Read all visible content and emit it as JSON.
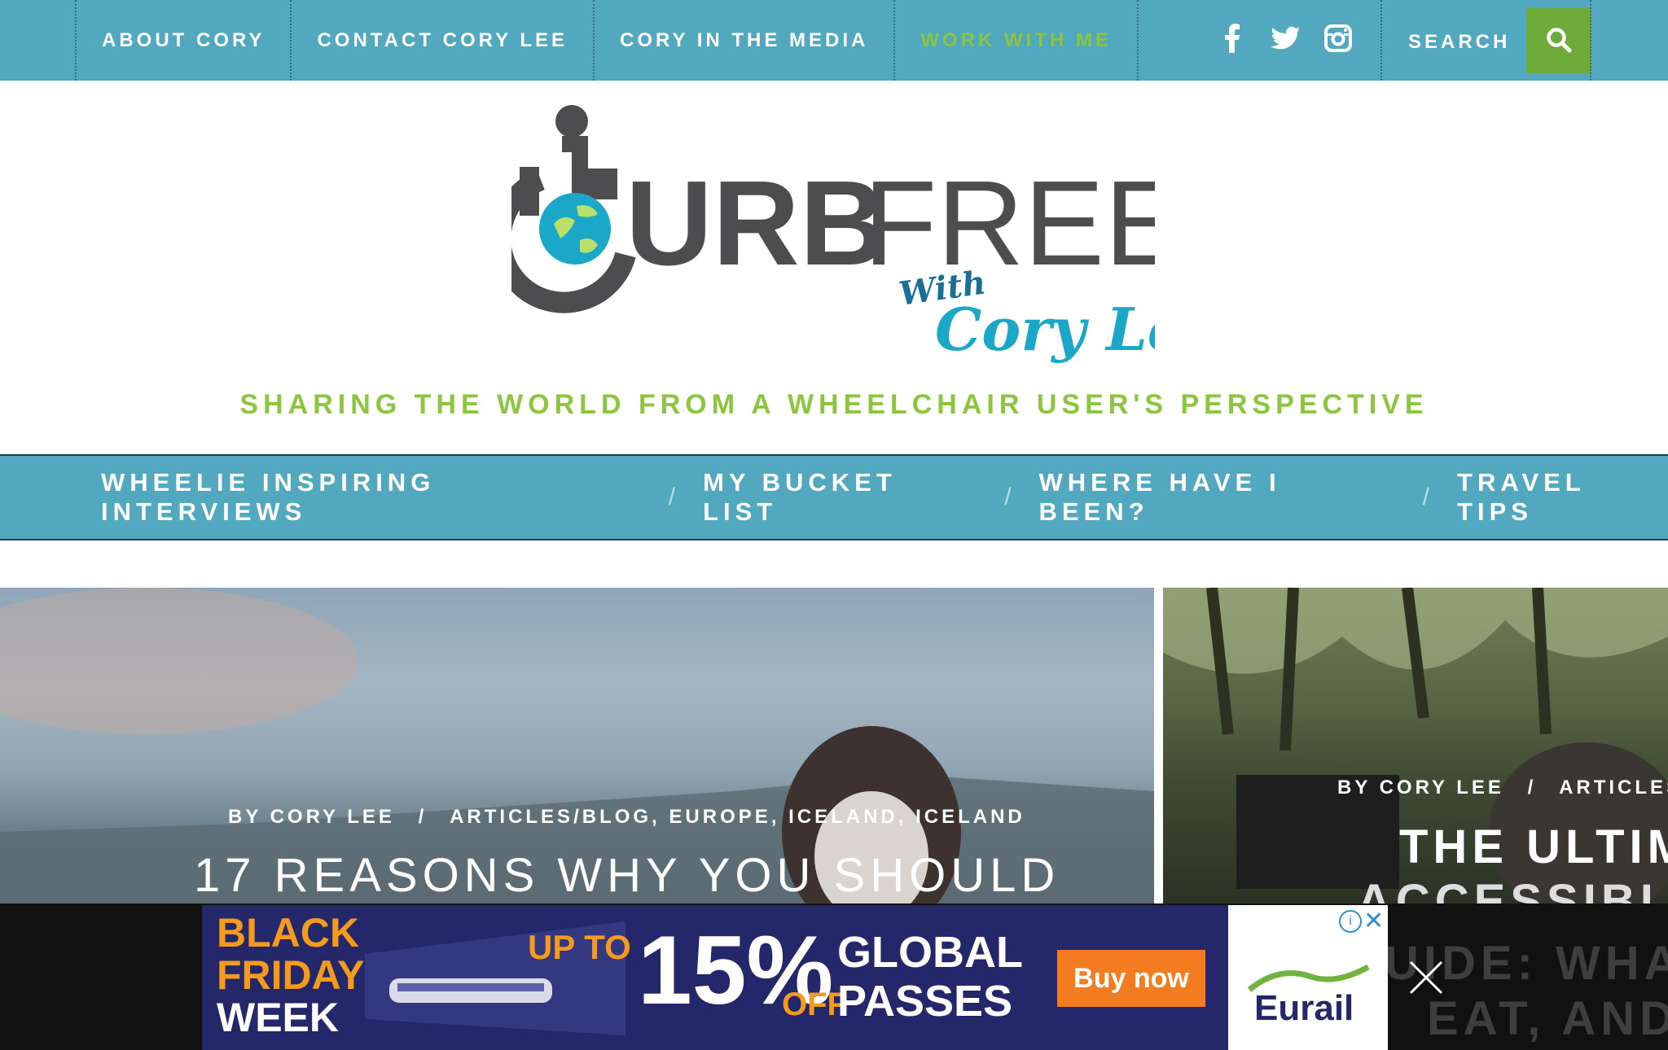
{
  "topnav": {
    "items": [
      "ABOUT CORY",
      "CONTACT CORY LEE",
      "CORY IN THE MEDIA",
      "WORK WITH ME"
    ]
  },
  "search": {
    "placeholder": "SEARCH"
  },
  "social": [
    "facebook-icon",
    "twitter-icon",
    "instagram-icon"
  ],
  "logo": {
    "main_dark": "URB",
    "main_light": "FREE",
    "with": "With",
    "name": "Cory Lee"
  },
  "tagline": "SHARING THE WORLD FROM A WHEELCHAIR USER'S PERSPECTIVE",
  "mainnav": {
    "items": [
      "WHEELIE INSPIRING INTERVIEWS",
      "MY BUCKET LIST",
      "WHERE HAVE I BEEN?",
      "TRAVEL TIPS"
    ],
    "separator": "/"
  },
  "featured": [
    {
      "byline": "BY CORY LEE",
      "sep": "/",
      "categories": "ARTICLES/BLOG, EUROPE, ICELAND, ICELAND",
      "title": "17 REASONS WHY YOU SHOULD"
    },
    {
      "byline": "BY CORY LEE",
      "sep": "/",
      "categories": "ARTICLES/BLOG",
      "title_line1": "THE ULTIMA",
      "title_line2": "ACCESSIBLE",
      "title_line3": "UIDE: WHAT",
      "title_line4": "EAT, AND"
    }
  ],
  "ad": {
    "line1": "BLACK",
    "line2": "FRIDAY",
    "line3": "WEEK",
    "upto": "UP TO",
    "percent": "15%",
    "off": "OFF",
    "global": "GLOBAL",
    "passes": "PASSES",
    "cta": "Buy now",
    "brand": "Eurail"
  },
  "colors": {
    "teal": "#52a9bf",
    "green": "#8cc63f",
    "search_button": "#6fab3a",
    "logo_dark": "#4d4d4f",
    "logo_blue": "#1ba8c8"
  }
}
